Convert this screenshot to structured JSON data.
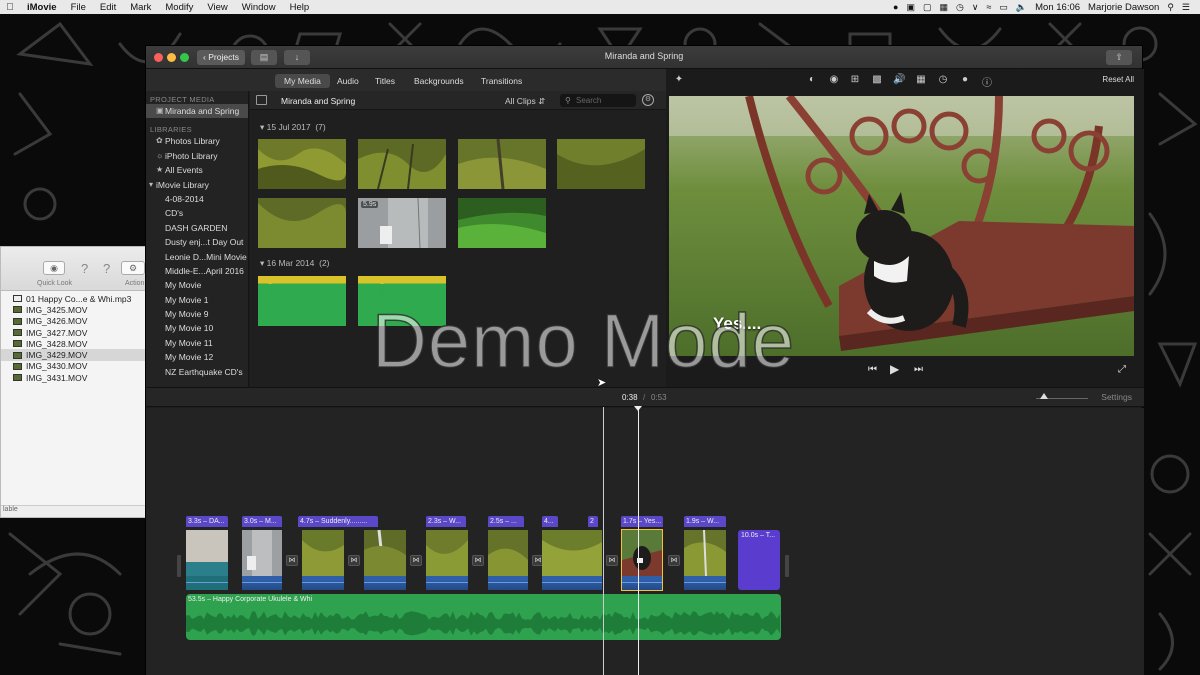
{
  "menubar": {
    "app_name": "iMovie",
    "menus": [
      "File",
      "Edit",
      "Mark",
      "Modify",
      "View",
      "Window",
      "Help"
    ],
    "clock": "Mon 16:06",
    "user": "Marjorie Dawson"
  },
  "finder": {
    "toolbar": {
      "quick_look_label": "Quick Look",
      "action_label": "Action"
    },
    "files": [
      {
        "name": "01 Happy Co...e & Whi.mp3",
        "kind": "audio"
      },
      {
        "name": "IMG_3425.MOV",
        "kind": "video"
      },
      {
        "name": "IMG_3426.MOV",
        "kind": "video"
      },
      {
        "name": "IMG_3427.MOV",
        "kind": "video"
      },
      {
        "name": "IMG_3428.MOV",
        "kind": "video"
      },
      {
        "name": "IMG_3429.MOV",
        "kind": "video",
        "selected": true
      },
      {
        "name": "IMG_3430.MOV",
        "kind": "video"
      },
      {
        "name": "IMG_3431.MOV",
        "kind": "video"
      }
    ],
    "status": "lable"
  },
  "window": {
    "title": "Miranda and Spring",
    "projects_button": "Projects"
  },
  "tabs": [
    "My Media",
    "Audio",
    "Titles",
    "Backgrounds",
    "Transitions"
  ],
  "active_tab": "My Media",
  "sidebar": {
    "project_media_heading": "PROJECT MEDIA",
    "project_item": "Miranda and Spring",
    "libraries_heading": "LIBRARIES",
    "libraries": [
      "Photos Library",
      "iPhoto Library",
      "All Events"
    ],
    "imovie_library_label": "iMovie Library",
    "events": [
      "4-08-2014",
      "CD's",
      "DASH GARDEN",
      "Dusty enj...t Day Out",
      "Leonie D...Mini Movie",
      "Middle-E...April 2016",
      "My Movie",
      "My Movie 1",
      "My Movie 9",
      "My Movie 10",
      "My Movie 11",
      "My Movie 12",
      "NZ Earthquake CD's"
    ]
  },
  "browser": {
    "title": "Miranda and Spring",
    "filter": "All Clips",
    "search_placeholder": "Search",
    "groups": [
      {
        "date": "15 Jul 2017",
        "count": "(7)"
      },
      {
        "date": "16 Mar 2014",
        "count": "(2)"
      }
    ],
    "clip_duration_badge": "5.9s"
  },
  "viewer": {
    "reset_all": "Reset All",
    "caption": "Yes...."
  },
  "timeline": {
    "current_time": "0:38",
    "separator": "/",
    "total_time": "0:53",
    "settings_label": "Settings",
    "zoom_level": 0.15,
    "clip_labels": [
      "3.3s – DA...",
      "3.0s – M...",
      "4.7s – Suddenly.........",
      "2.3s – W...",
      "2.5s – ...",
      "4...",
      "2",
      "1.7s – Yes...",
      "1.9s – W..."
    ],
    "title_clip": "10.0s – T...",
    "music_label": "53.5s – Happy Corporate Ukulele & Whi"
  },
  "overlay": {
    "watermark": "Demo Mode"
  },
  "colors": {
    "accent_selected": "#f4c330",
    "clip_label": "#5a48c8",
    "audio_track": "#2ea24e",
    "title_clip": "#5a3ccf"
  }
}
